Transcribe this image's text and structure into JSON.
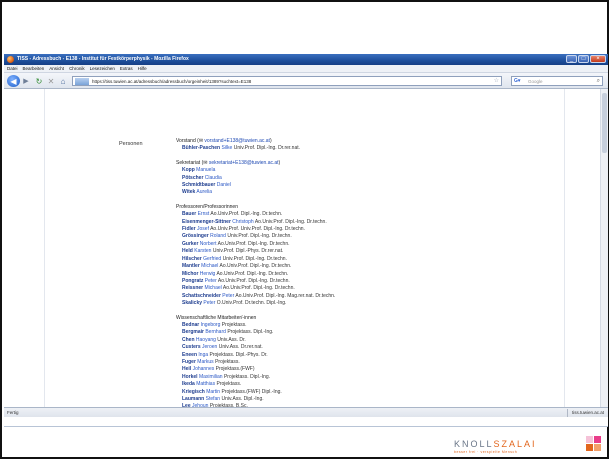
{
  "browser": {
    "title": "TISS - Adressbuch - E138 - Institut für Festkörperphysik - Mozilla Firefox",
    "menu": [
      "Datei",
      "Bearbeiten",
      "Ansicht",
      "Chronik",
      "Lesezeichen",
      "Extras",
      "Hilfe"
    ],
    "url": "https://tiss.tuwien.ac.at/adressbuch/adressbuch/orgeinheit/1389?suchtext=E138",
    "search_placeholder": "Google",
    "status": "Fertig",
    "status_domain": "tiss.tuwien.ac.at"
  },
  "page": {
    "section_label": "Personen",
    "sections": [
      {
        "heading": "Vorstand",
        "email": "vorstand+E138@tuwien.ac.at",
        "entries": [
          {
            "last": "Bühler-Paschen",
            "first": "Silke",
            "titles": "Univ.Prof. Dipl.-Ing. Dr.rer.nat."
          }
        ]
      },
      {
        "heading": "Sekretariat",
        "email": "sekretariat+E138@tuwien.ac.at",
        "entries": [
          {
            "last": "Kopp",
            "first": "Manuela",
            "titles": ""
          },
          {
            "last": "Pötscher",
            "first": "Claudia",
            "titles": ""
          },
          {
            "last": "Schmidtbauer",
            "first": "Daniel",
            "titles": ""
          },
          {
            "last": "Witek",
            "first": "Aurelia",
            "titles": ""
          }
        ]
      },
      {
        "heading": "Professoren/Professorinnen",
        "email": "",
        "entries": [
          {
            "last": "Bauer",
            "first": "Ernst",
            "titles": "Ao.Univ.Prof. Dipl.-Ing. Dr.techn."
          },
          {
            "last": "Eisenmenger-Sittner",
            "first": "Christoph",
            "titles": "Ao.Univ.Prof. Dipl.-Ing. Dr.techn."
          },
          {
            "last": "Fidler",
            "first": "Josef",
            "titles": "Ao.Univ.Prof. Univ.Prof. Dipl.-Ing. Dr.techn."
          },
          {
            "last": "Grössinger",
            "first": "Roland",
            "titles": "Univ.Prof. Dipl.-Ing. Dr.techn."
          },
          {
            "last": "Gurker",
            "first": "Norbert",
            "titles": "Ao.Univ.Prof. Dipl.-Ing. Dr.techn."
          },
          {
            "last": "Held",
            "first": "Karsten",
            "titles": "Univ.Prof. Dipl.-Phys. Dr.rer.nat."
          },
          {
            "last": "Hilscher",
            "first": "Gerfried",
            "titles": "Univ.Prof. Dipl.-Ing. Dr.techn."
          },
          {
            "last": "Mantler",
            "first": "Michael",
            "titles": "Ao.Univ.Prof. Dipl.-Ing. Dr.techn."
          },
          {
            "last": "Michor",
            "first": "Herwig",
            "titles": "Ao.Univ.Prof. Dipl.-Ing. Dr.techn."
          },
          {
            "last": "Pongratz",
            "first": "Peter",
            "titles": "Ao.Univ.Prof. Dipl.-Ing. Dr.techn."
          },
          {
            "last": "Reissner",
            "first": "Michael",
            "titles": "Ao.Univ.Prof. Dipl.-Ing. Dr.techn."
          },
          {
            "last": "Schattschneider",
            "first": "Peter",
            "titles": "Ao.Univ.Prof. Dipl.-Ing. Mag.rer.nat. Dr.techn."
          },
          {
            "last": "Skalicky",
            "first": "Peter",
            "titles": "O.Univ.Prof. Dr.techn. Dipl.-Ing."
          }
        ]
      },
      {
        "heading": "Wissenschaftliche Mitarbeiter/-innen",
        "email": "",
        "entries": [
          {
            "last": "Bednar",
            "first": "Ingeborg",
            "titles": "Projektass."
          },
          {
            "last": "Bergmair",
            "first": "Bernhard",
            "titles": "Projektass. Dipl.-Ing."
          },
          {
            "last": "Chen",
            "first": "Haoyang",
            "titles": "Univ.Ass. Dr."
          },
          {
            "last": "Custers",
            "first": "Jeroen",
            "titles": "Univ.Ass. Dr.rer.nat."
          },
          {
            "last": "Eneen",
            "first": "Inga",
            "titles": "Projektass. Dipl.-Phys. Dr."
          },
          {
            "last": "Fuger",
            "first": "Markus",
            "titles": "Projektass."
          },
          {
            "last": "Heil",
            "first": "Johannes",
            "titles": "Projektass.(FWF)"
          },
          {
            "last": "Horkel",
            "first": "Maximilian",
            "titles": "Projektass. Dipl.-Ing."
          },
          {
            "last": "Ikeda",
            "first": "Matthias",
            "titles": "Projektass."
          },
          {
            "last": "Kriegisch",
            "first": "Martin",
            "titles": "Projektass.(FWF) Dipl.-Ing."
          },
          {
            "last": "Laumann",
            "first": "Stefan",
            "titles": "Univ.Ass. Dipl.-Ing."
          },
          {
            "last": "Lee",
            "first": "Jehoun",
            "titles": "Projektass. B.Sc."
          }
        ]
      }
    ]
  },
  "logo": {
    "word_left": "KNOLL",
    "word_right": "SZALAI",
    "tagline": "besser frei · verspielte Mensch"
  }
}
